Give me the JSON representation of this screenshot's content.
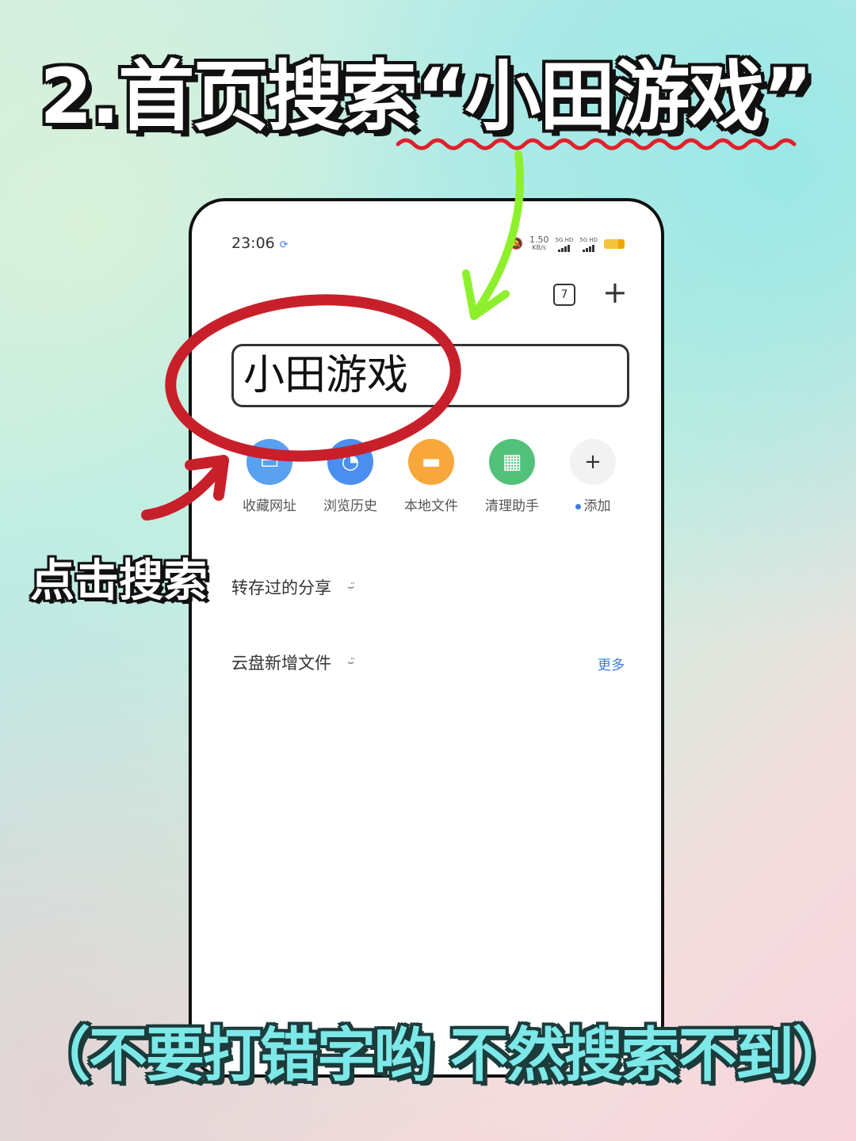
{
  "headline": "2.首页搜索“小田游戏”",
  "colors": {
    "annotation_red": "#c8202a",
    "annotation_green": "#8ef02c",
    "link_blue": "#3b7be6",
    "bottom_note": "#7de8e8"
  },
  "status_bar": {
    "time": "23:06",
    "sync_icon": "sync-icon",
    "net_speed": "1.50",
    "net_unit": "KB/s",
    "sim1": "5G HD",
    "sim2": "5G HD"
  },
  "toolbar": {
    "tab_count": "7"
  },
  "search": {
    "value": "小田游戏"
  },
  "shortcuts": [
    {
      "label": "收藏网址",
      "icon": "bookmark-icon",
      "color": "#5aa0f0"
    },
    {
      "label": "浏览历史",
      "icon": "history-icon",
      "color": "#4a8ef0"
    },
    {
      "label": "本地文件",
      "icon": "folder-icon",
      "color": "#f8a83a"
    },
    {
      "label": "清理助手",
      "icon": "broom-icon",
      "color": "#52c27a"
    },
    {
      "label": "添加",
      "icon": "plus-icon",
      "color": "#f2f2f2"
    }
  ],
  "sections": {
    "shared": "转存过的分享",
    "cloud": "云盘新增文件",
    "more": "更多"
  },
  "annotations": {
    "tap_label": "点击搜索",
    "bottom_note": "（不要打错字哟  不然搜索不到）"
  }
}
